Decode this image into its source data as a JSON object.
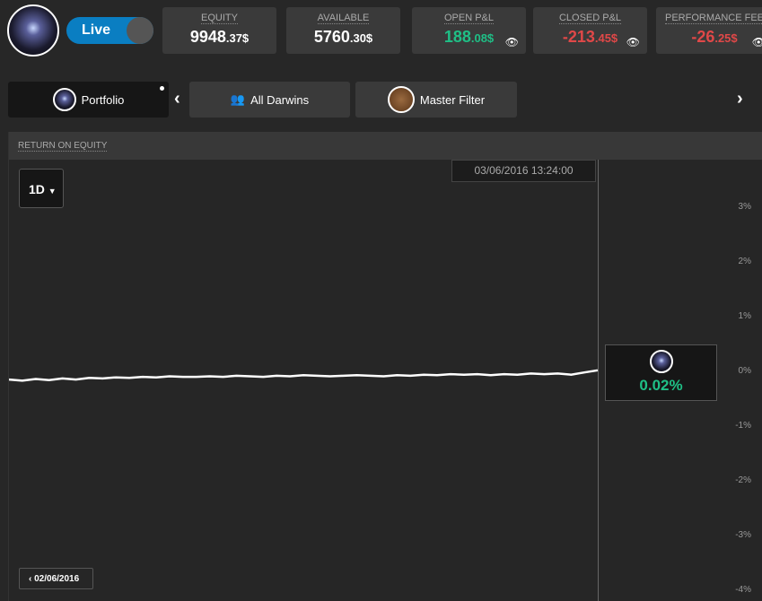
{
  "header": {
    "mode_label": "Live",
    "stats": [
      {
        "title": "EQUITY",
        "int": "9948",
        "dec": ".37$",
        "color": "#ffffff"
      },
      {
        "title": "AVAILABLE",
        "int": "5760",
        "dec": ".30$",
        "color": "#ffffff"
      },
      {
        "title": "OPEN P&L",
        "int": "188",
        "dec": ".08$",
        "color": "#1fbf86"
      },
      {
        "title": "CLOSED P&L",
        "int": "-213",
        "dec": ".45$",
        "color": "#e04848"
      },
      {
        "title": "PERFORMANCE FEE",
        "int": "-26",
        "dec": ".25$",
        "color": "#e04848"
      }
    ]
  },
  "tabs": [
    {
      "label": "Portfolio"
    },
    {
      "label": "All Darwins"
    },
    {
      "label": "Master Filter"
    }
  ],
  "panel": {
    "title": "RETURN ON EQUITY",
    "period": "1D",
    "crosshair_time": "03/06/2016 13:24:00",
    "tooltip_value": "0.02%",
    "prev_date": "02/06/2016"
  },
  "chart_data": {
    "type": "line",
    "title": "RETURN ON EQUITY",
    "ylabel": "",
    "xlabel": "",
    "y_ticks": [
      "3%",
      "2%",
      "1%",
      "0%",
      "-1%",
      "-2%",
      "-3%",
      "-4%"
    ],
    "ylim": [
      -4,
      3.3
    ],
    "values": [
      -0.15,
      -0.17,
      -0.14,
      -0.16,
      -0.13,
      -0.15,
      -0.12,
      -0.13,
      -0.11,
      -0.12,
      -0.1,
      -0.11,
      -0.09,
      -0.1,
      -0.1,
      -0.09,
      -0.1,
      -0.08,
      -0.09,
      -0.1,
      -0.08,
      -0.09,
      -0.07,
      -0.08,
      -0.09,
      -0.08,
      -0.07,
      -0.08,
      -0.09,
      -0.07,
      -0.08,
      -0.06,
      -0.07,
      -0.05,
      -0.06,
      -0.05,
      -0.07,
      -0.05,
      -0.06,
      -0.04,
      -0.05,
      -0.04,
      -0.06,
      -0.02,
      0.02
    ]
  }
}
